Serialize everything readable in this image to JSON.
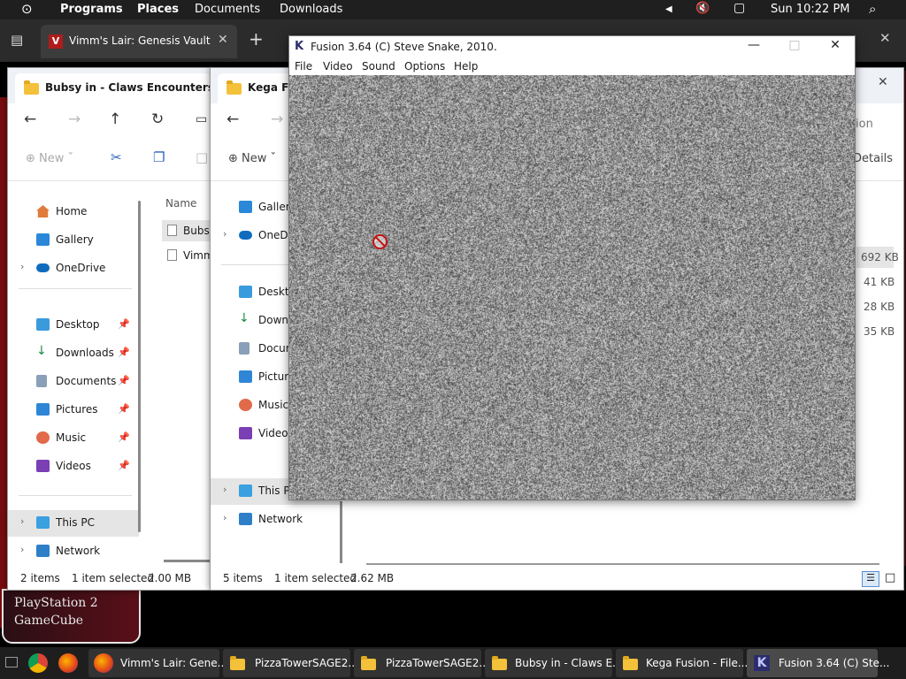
{
  "top_panel": {
    "menu": [
      "Programs",
      "Places",
      "Documents",
      "Downloads"
    ],
    "clock": "Sun 10:22 PM"
  },
  "browser": {
    "tab_title": "Vimm's Lair: Genesis Vault"
  },
  "background_page": {
    "console_links": [
      "PlayStation 2",
      "GameCube"
    ]
  },
  "explorer_back": {
    "tab_title": "Bubsy in - Claws Encounters o",
    "new_label": "New",
    "column_name": "Name",
    "files": [
      "Bubsy",
      "Vimm"
    ],
    "sidebar": {
      "home": "Home",
      "gallery": "Gallery",
      "onedrive": "OneDrive",
      "desktop": "Desktop",
      "downloads": "Downloads",
      "documents": "Documents",
      "pictures": "Pictures",
      "music": "Music",
      "videos": "Videos",
      "this_pc": "This PC",
      "network": "Network"
    },
    "status": {
      "items": "2 items",
      "selected": "1 item selected",
      "size": "2.00 MB"
    }
  },
  "explorer_front": {
    "tab_title": "Kega Fus",
    "new_label": "New",
    "details_label": "Details",
    "partial_header": "ion",
    "sizes": [
      "692 KB",
      "41 KB",
      "28 KB",
      "35 KB"
    ],
    "sidebar": {
      "gallery": "Gallery",
      "onedrive": "OneDr",
      "desktop": "Deskto",
      "downloads": "Downl",
      "documents": "Docum",
      "pictures": "Picture",
      "music": "Music",
      "videos": "Videos",
      "this_pc": "This P",
      "network": "Network"
    },
    "status": {
      "items": "5 items",
      "selected": "1 item selected",
      "size": "2.62 MB"
    }
  },
  "fusion": {
    "title": "Fusion 3.64 (C) Steve Snake, 2010.",
    "menu": [
      "File",
      "Video",
      "Sound",
      "Options",
      "Help"
    ]
  },
  "taskbar": {
    "items": [
      "Vimm's Lair: Gene...",
      "PizzaTowerSAGE2...",
      "PizzaTowerSAGE2...",
      "Bubsy in - Claws E...",
      "Kega Fusion - File...",
      "Fusion 3.64 (C) Ste..."
    ]
  }
}
